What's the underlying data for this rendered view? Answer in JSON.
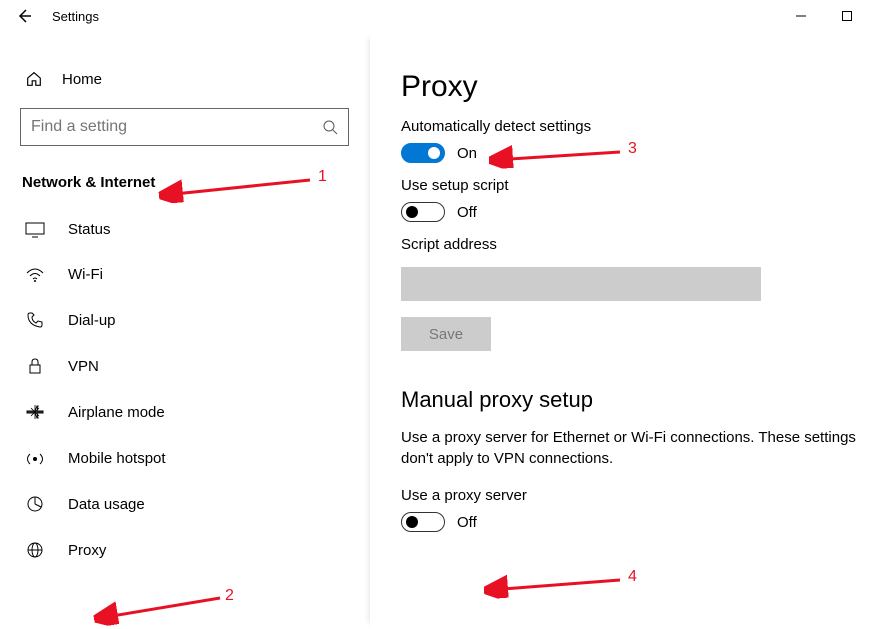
{
  "window": {
    "title": "Settings"
  },
  "home": {
    "label": "Home"
  },
  "search": {
    "placeholder": "Find a setting"
  },
  "category": "Network & Internet",
  "nav": [
    {
      "label": "Status"
    },
    {
      "label": "Wi-Fi"
    },
    {
      "label": "Dial-up"
    },
    {
      "label": "VPN"
    },
    {
      "label": "Airplane mode"
    },
    {
      "label": "Mobile hotspot"
    },
    {
      "label": "Data usage"
    },
    {
      "label": "Proxy"
    }
  ],
  "page": {
    "title": "Proxy",
    "autoDetect": {
      "label": "Automatically detect settings",
      "state": "On"
    },
    "setupScript": {
      "label": "Use setup script",
      "state": "Off"
    },
    "scriptAddress": {
      "label": "Script address",
      "value": ""
    },
    "saveLabel": "Save",
    "manualHeading": "Manual proxy setup",
    "manualDesc": "Use a proxy server for Ethernet or Wi-Fi connections. These settings don't apply to VPN connections.",
    "useProxy": {
      "label": "Use a proxy server",
      "state": "Off"
    }
  },
  "annotations": {
    "n1": "1",
    "n2": "2",
    "n3": "3",
    "n4": "4"
  }
}
